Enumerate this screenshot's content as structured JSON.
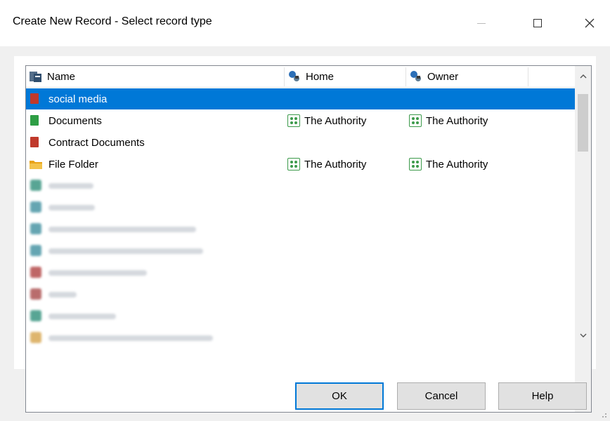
{
  "window": {
    "title": "Create New Record - Select record type"
  },
  "columns": [
    {
      "label": "Name"
    },
    {
      "label": "Home"
    },
    {
      "label": "Owner"
    }
  ],
  "rows": [
    {
      "name": "social media",
      "home": "",
      "owner": "",
      "icon_color": "#c0392b",
      "selected": true
    },
    {
      "name": "Documents",
      "home": "The Authority",
      "owner": "The Authority",
      "icon_color": "#2e9e45",
      "selected": false
    },
    {
      "name": "Contract Documents",
      "home": "",
      "owner": "",
      "icon_color": "#c0392b",
      "selected": false
    },
    {
      "name": "File Folder",
      "home": "The Authority",
      "owner": "The Authority",
      "icon_color": "#e8a317",
      "selected": false
    }
  ],
  "buttons": {
    "ok": "OK",
    "cancel": "Cancel",
    "help": "Help"
  },
  "colors": {
    "selection": "#0078d7",
    "group_icon": "#3c9a4b"
  }
}
